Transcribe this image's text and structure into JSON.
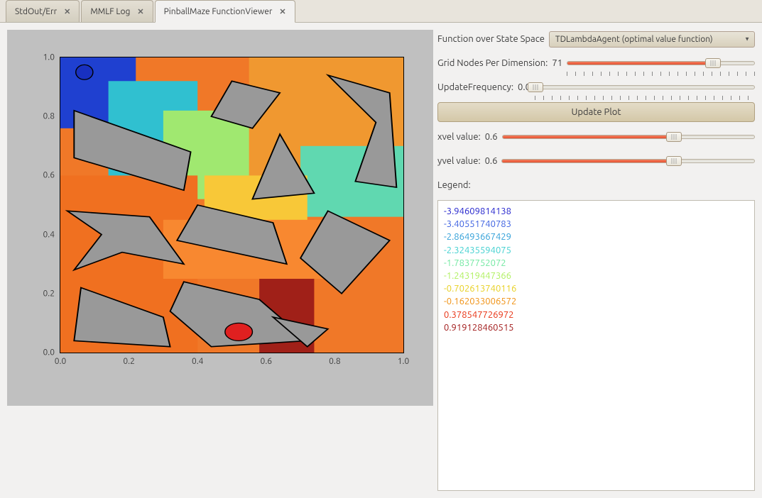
{
  "tabs": [
    {
      "label": "StdOut/Err",
      "active": false
    },
    {
      "label": "MMLF Log",
      "active": false
    },
    {
      "label": "PinballMaze FunctionViewer",
      "active": true
    }
  ],
  "controls": {
    "function_label": "Function over State Space",
    "function_value": "TDLambdaAgent (optimal value function)",
    "grid_label": "Grid Nodes Per Dimension:",
    "grid_value": "71",
    "grid_pct": 78,
    "update_freq_label": "UpdateFrequency:",
    "update_freq_value": "0.0",
    "update_freq_pct": 0,
    "update_btn": "Update Plot",
    "xvel_label": "xvel value:",
    "xvel_value": "0.6",
    "xvel_pct": 68,
    "yvel_label": "yvel value:",
    "yvel_value": "0.6",
    "yvel_pct": 68,
    "legend_label": "Legend:"
  },
  "legend": [
    {
      "text": "-3.94609814138",
      "color": "#1f1fcc"
    },
    {
      "text": "-3.40551740783",
      "color": "#3a5fe0"
    },
    {
      "text": "-2.86493667429",
      "color": "#2f9fd8"
    },
    {
      "text": "-2.32435594075",
      "color": "#40d0d0"
    },
    {
      "text": "-1.7837752072",
      "color": "#70e8a0"
    },
    {
      "text": "-1.24319447366",
      "color": "#b0f060"
    },
    {
      "text": "-0.702613740116",
      "color": "#e8d020"
    },
    {
      "text": "-0.162033006572",
      "color": "#f09010"
    },
    {
      "text": "0.378547726972",
      "color": "#e83010"
    },
    {
      "text": "0.919128460515",
      "color": "#a01818"
    }
  ],
  "chart_data": {
    "type": "heatmap",
    "title": "",
    "xlabel": "",
    "ylabel": "",
    "xlim": [
      0.0,
      1.0
    ],
    "ylim": [
      0.0,
      1.0
    ],
    "x_ticks": [
      "0.0",
      "0.2",
      "0.4",
      "0.6",
      "0.8",
      "1.0"
    ],
    "y_ticks": [
      "0.0",
      "0.2",
      "0.4",
      "0.6",
      "0.8",
      "1.0"
    ],
    "color_range": [
      -3.94609814138,
      0.919128460515
    ],
    "ball_start": {
      "x": 0.07,
      "y": 0.95,
      "color": "#1830c0"
    },
    "ball_goal": {
      "x": 0.52,
      "y": 0.07,
      "color": "#e02020"
    },
    "obstacles_approx": [
      [
        [
          0.04,
          0.82
        ],
        [
          0.38,
          0.68
        ],
        [
          0.36,
          0.55
        ],
        [
          0.04,
          0.66
        ]
      ],
      [
        [
          0.5,
          0.92
        ],
        [
          0.64,
          0.88
        ],
        [
          0.56,
          0.76
        ],
        [
          0.44,
          0.8
        ]
      ],
      [
        [
          0.78,
          0.94
        ],
        [
          0.92,
          0.78
        ],
        [
          0.86,
          0.58
        ],
        [
          0.98,
          0.56
        ],
        [
          0.96,
          0.88
        ]
      ],
      [
        [
          0.64,
          0.74
        ],
        [
          0.74,
          0.54
        ],
        [
          0.56,
          0.52
        ]
      ],
      [
        [
          0.02,
          0.48
        ],
        [
          0.26,
          0.46
        ],
        [
          0.36,
          0.3
        ],
        [
          0.18,
          0.34
        ],
        [
          0.04,
          0.28
        ],
        [
          0.12,
          0.4
        ]
      ],
      [
        [
          0.4,
          0.5
        ],
        [
          0.62,
          0.44
        ],
        [
          0.66,
          0.3
        ],
        [
          0.34,
          0.38
        ]
      ],
      [
        [
          0.78,
          0.48
        ],
        [
          0.96,
          0.38
        ],
        [
          0.82,
          0.2
        ],
        [
          0.7,
          0.32
        ]
      ],
      [
        [
          0.06,
          0.22
        ],
        [
          0.3,
          0.12
        ],
        [
          0.32,
          0.02
        ],
        [
          0.04,
          0.04
        ]
      ],
      [
        [
          0.36,
          0.24
        ],
        [
          0.58,
          0.18
        ],
        [
          0.72,
          0.04
        ],
        [
          0.44,
          0.02
        ],
        [
          0.32,
          0.14
        ]
      ],
      [
        [
          0.62,
          0.12
        ],
        [
          0.78,
          0.08
        ],
        [
          0.72,
          0.02
        ]
      ]
    ],
    "heatmap_regions": [
      {
        "x": [
          0.02,
          0.22
        ],
        "y": [
          0.78,
          0.98
        ],
        "color": "#1f40d0"
      },
      {
        "x": [
          0.18,
          0.4
        ],
        "y": [
          0.6,
          0.88
        ],
        "color": "#30c0d0"
      },
      {
        "x": [
          0.35,
          0.6
        ],
        "y": [
          0.55,
          0.78
        ],
        "color": "#a0e870"
      },
      {
        "x": [
          0.0,
          1.0
        ],
        "y": [
          0.0,
          0.6
        ],
        "color": "#f08020"
      },
      {
        "x": [
          0.6,
          1.0
        ],
        "y": [
          0.5,
          1.0
        ],
        "color": "#f09830"
      },
      {
        "x": [
          0.6,
          0.72
        ],
        "y": [
          0.02,
          0.3
        ],
        "color": "#a02018"
      },
      {
        "x": [
          0.72,
          1.0
        ],
        "y": [
          0.4,
          0.6
        ],
        "color": "#60d8b0"
      }
    ]
  }
}
